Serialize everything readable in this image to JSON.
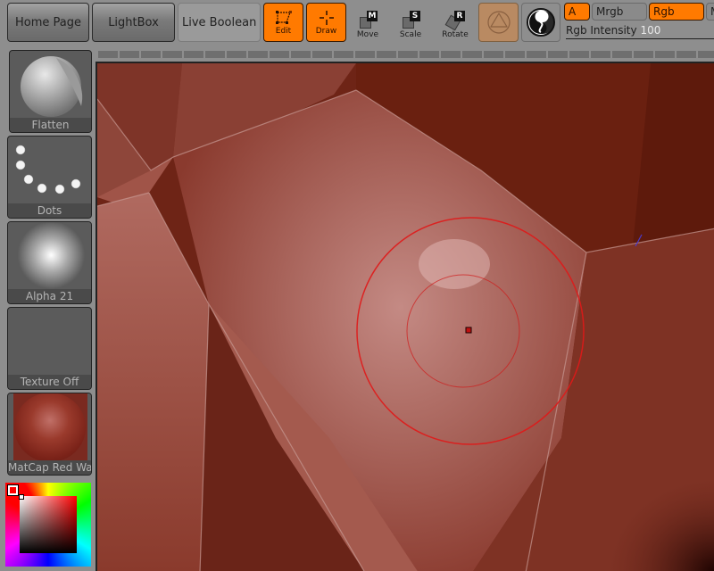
{
  "topbar": {
    "home_page": "Home Page",
    "lightbox": "LightBox",
    "live_boolean": "Live Boolean",
    "edit": "Edit",
    "draw": "Draw",
    "move": "Move",
    "move_key": "M",
    "scale": "Scale",
    "scale_key": "S",
    "rotate": "Rotate",
    "rotate_key": "R",
    "a_toggle": "A",
    "mrgb": "Mrgb",
    "rgb": "Rgb",
    "m_partial": "M",
    "rgb_intensity_label": "Rgb Intensity",
    "rgb_intensity_value": "100"
  },
  "sidebar": {
    "brush": "Flatten",
    "stroke": "Dots",
    "alpha": "Alpha 21",
    "texture": "Texture Off",
    "material": "MatCap Red Wax"
  },
  "colors": {
    "accent": "#ff7a00",
    "primary_color": "#ff0000",
    "brush_ring": "#e01818"
  }
}
